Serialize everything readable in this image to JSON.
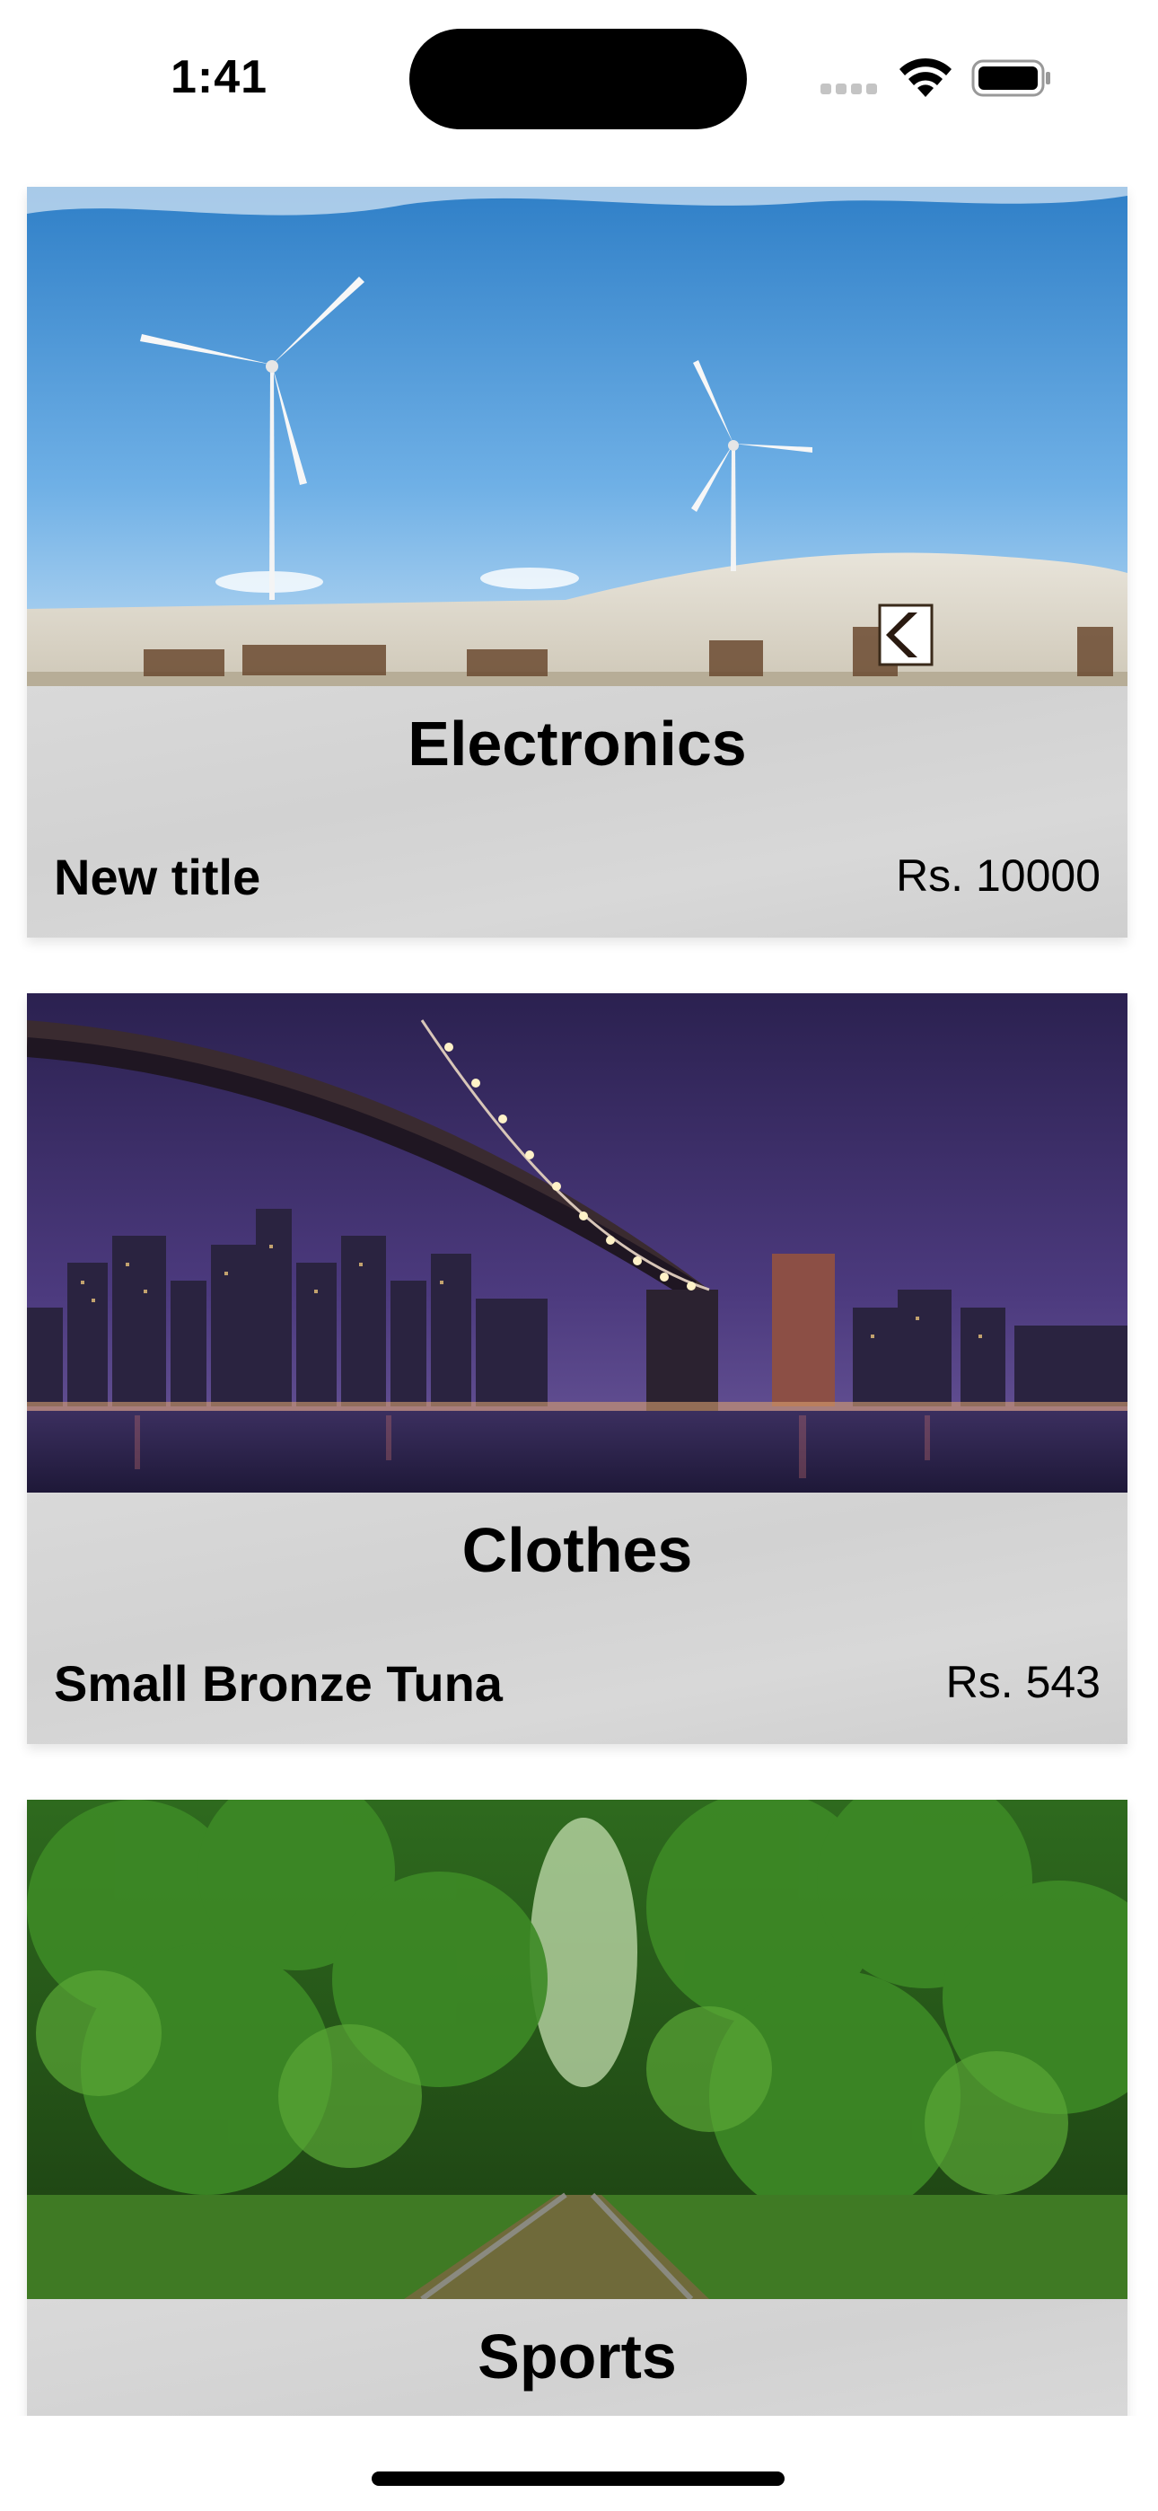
{
  "status_bar": {
    "time": "1:41",
    "icons": [
      "cellular-signal-icon",
      "wifi-icon",
      "battery-icon"
    ]
  },
  "categories": [
    {
      "name": "Electronics",
      "product_title": "New title",
      "price": "Rs. 10000",
      "image": "wind-turbines-photo"
    },
    {
      "name": "Clothes",
      "product_title": "Small Bronze Tuna",
      "price": "Rs. 543",
      "image": "night-bridge-skyline-photo"
    },
    {
      "name": "Sports",
      "product_title": "",
      "price": "",
      "image": "forest-railway-photo"
    }
  ],
  "colors": {
    "card_footer": "#d6d6d6",
    "text": "#000000",
    "background": "#ffffff"
  }
}
